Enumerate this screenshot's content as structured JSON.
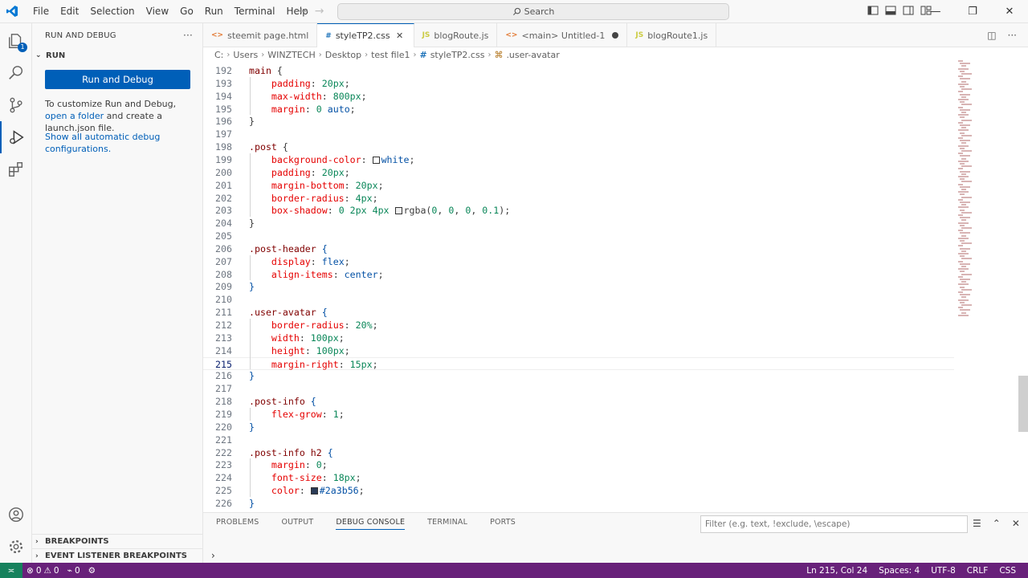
{
  "titlebar": {
    "menu": [
      "File",
      "Edit",
      "Selection",
      "View",
      "Go",
      "Run",
      "Terminal",
      "Help"
    ],
    "search_placeholder": "Search"
  },
  "sidebar": {
    "title": "RUN AND DEBUG",
    "section": "RUN",
    "run_button": "Run and Debug",
    "para1_prefix": "To customize Run and Debug, ",
    "para1_link": "open a folder",
    "para1_suffix": " and create a launch.json file.",
    "show_all_link": "Show all automatic debug configurations.",
    "breakpoints": "BREAKPOINTS",
    "event_breakpoints": "EVENT LISTENER BREAKPOINTS"
  },
  "tabs": [
    {
      "icon": "<>",
      "label": "steemit page.html"
    },
    {
      "icon": "#",
      "label": "styleTP2.css"
    },
    {
      "icon": "JS",
      "label": "blogRoute.js"
    },
    {
      "icon": "<>",
      "label": "<main>  Untitled-1"
    },
    {
      "icon": "JS",
      "label": "blogRoute1.js"
    }
  ],
  "breadcrumb": [
    "C:",
    "Users",
    "WINZTECH",
    "Desktop",
    "test file1",
    "styleTP2.css",
    ".user-avatar"
  ],
  "editor": {
    "current_line": 215,
    "lines": [
      {
        "n": "192",
        "tokens": [
          [
            "sel",
            "main "
          ],
          [
            "brace",
            "{"
          ]
        ]
      },
      {
        "n": "193",
        "tokens": [
          [
            "sp",
            "    "
          ],
          [
            "prop",
            "padding"
          ],
          [
            "brace",
            ": "
          ],
          [
            "num",
            "20px"
          ],
          [
            "brace",
            ";"
          ]
        ]
      },
      {
        "n": "194",
        "tokens": [
          [
            "sp",
            "    "
          ],
          [
            "prop",
            "max-width"
          ],
          [
            "brace",
            ": "
          ],
          [
            "num",
            "800px"
          ],
          [
            "brace",
            ";"
          ]
        ]
      },
      {
        "n": "195",
        "tokens": [
          [
            "sp",
            "    "
          ],
          [
            "prop",
            "margin"
          ],
          [
            "brace",
            ": "
          ],
          [
            "num",
            "0"
          ],
          [
            "brace",
            " "
          ],
          [
            "val",
            "auto"
          ],
          [
            "brace",
            ";"
          ]
        ]
      },
      {
        "n": "196",
        "tokens": [
          [
            "brace",
            "}"
          ]
        ]
      },
      {
        "n": "197",
        "tokens": []
      },
      {
        "n": "198",
        "tokens": [
          [
            "sel",
            ".post "
          ],
          [
            "brace",
            "{"
          ]
        ]
      },
      {
        "n": "199",
        "tokens": [
          [
            "sp",
            "    "
          ],
          [
            "prop",
            "background-color"
          ],
          [
            "brace",
            ": "
          ],
          [
            "swatch",
            "#ffffff"
          ],
          [
            "val",
            "white"
          ],
          [
            "brace",
            ";"
          ]
        ]
      },
      {
        "n": "200",
        "tokens": [
          [
            "sp",
            "    "
          ],
          [
            "prop",
            "padding"
          ],
          [
            "brace",
            ": "
          ],
          [
            "num",
            "20px"
          ],
          [
            "brace",
            ";"
          ]
        ]
      },
      {
        "n": "201",
        "tokens": [
          [
            "sp",
            "    "
          ],
          [
            "prop",
            "margin-bottom"
          ],
          [
            "brace",
            ": "
          ],
          [
            "num",
            "20px"
          ],
          [
            "brace",
            ";"
          ]
        ]
      },
      {
        "n": "202",
        "tokens": [
          [
            "sp",
            "    "
          ],
          [
            "prop",
            "border-radius"
          ],
          [
            "brace",
            ": "
          ],
          [
            "num",
            "4px"
          ],
          [
            "brace",
            ";"
          ]
        ]
      },
      {
        "n": "203",
        "tokens": [
          [
            "sp",
            "    "
          ],
          [
            "prop",
            "box-shadow"
          ],
          [
            "brace",
            ": "
          ],
          [
            "num",
            "0 2px 4px "
          ],
          [
            "swatch",
            "#f0f0f0"
          ],
          [
            "brace",
            "rgba("
          ],
          [
            "num",
            "0"
          ],
          [
            "brace",
            ", "
          ],
          [
            "num",
            "0"
          ],
          [
            "brace",
            ", "
          ],
          [
            "num",
            "0"
          ],
          [
            "brace",
            ", "
          ],
          [
            "num",
            "0.1"
          ],
          [
            "brace",
            ");"
          ]
        ]
      },
      {
        "n": "204",
        "tokens": [
          [
            "brace",
            "}"
          ]
        ]
      },
      {
        "n": "205",
        "tokens": []
      },
      {
        "n": "206",
        "tokens": [
          [
            "sel",
            ".post-header "
          ],
          [
            "val",
            "{"
          ]
        ]
      },
      {
        "n": "207",
        "tokens": [
          [
            "sp",
            "    "
          ],
          [
            "prop",
            "display"
          ],
          [
            "brace",
            ": "
          ],
          [
            "val",
            "flex"
          ],
          [
            "brace",
            ";"
          ]
        ]
      },
      {
        "n": "208",
        "tokens": [
          [
            "sp",
            "    "
          ],
          [
            "prop",
            "align-items"
          ],
          [
            "brace",
            ": "
          ],
          [
            "val",
            "center"
          ],
          [
            "brace",
            ";"
          ]
        ]
      },
      {
        "n": "209",
        "tokens": [
          [
            "val",
            "}"
          ]
        ]
      },
      {
        "n": "210",
        "tokens": []
      },
      {
        "n": "211",
        "tokens": [
          [
            "sel",
            ".user-avatar "
          ],
          [
            "val",
            "{"
          ]
        ]
      },
      {
        "n": "212",
        "tokens": [
          [
            "sp",
            "    "
          ],
          [
            "prop",
            "border-radius"
          ],
          [
            "brace",
            ": "
          ],
          [
            "num",
            "20%"
          ],
          [
            "brace",
            ";"
          ]
        ]
      },
      {
        "n": "213",
        "tokens": [
          [
            "sp",
            "    "
          ],
          [
            "prop",
            "width"
          ],
          [
            "brace",
            ": "
          ],
          [
            "num",
            "100px"
          ],
          [
            "brace",
            ";"
          ]
        ]
      },
      {
        "n": "214",
        "tokens": [
          [
            "sp",
            "    "
          ],
          [
            "prop",
            "height"
          ],
          [
            "brace",
            ": "
          ],
          [
            "num",
            "100px"
          ],
          [
            "brace",
            ";"
          ]
        ]
      },
      {
        "n": "215",
        "tokens": [
          [
            "sp",
            "    "
          ],
          [
            "prop",
            "margin-right"
          ],
          [
            "brace",
            ": "
          ],
          [
            "num",
            "15px"
          ],
          [
            "brace",
            ";"
          ]
        ]
      },
      {
        "n": "216",
        "tokens": [
          [
            "val",
            "}"
          ]
        ]
      },
      {
        "n": "217",
        "tokens": []
      },
      {
        "n": "218",
        "tokens": [
          [
            "sel",
            ".post-info "
          ],
          [
            "val",
            "{"
          ]
        ]
      },
      {
        "n": "219",
        "tokens": [
          [
            "sp",
            "    "
          ],
          [
            "prop",
            "flex-grow"
          ],
          [
            "brace",
            ": "
          ],
          [
            "num",
            "1"
          ],
          [
            "brace",
            ";"
          ]
        ]
      },
      {
        "n": "220",
        "tokens": [
          [
            "val",
            "}"
          ]
        ]
      },
      {
        "n": "221",
        "tokens": []
      },
      {
        "n": "222",
        "tokens": [
          [
            "sel",
            ".post-info h2 "
          ],
          [
            "val",
            "{"
          ]
        ]
      },
      {
        "n": "223",
        "tokens": [
          [
            "sp",
            "    "
          ],
          [
            "prop",
            "margin"
          ],
          [
            "brace",
            ": "
          ],
          [
            "num",
            "0"
          ],
          [
            "brace",
            ";"
          ]
        ]
      },
      {
        "n": "224",
        "tokens": [
          [
            "sp",
            "    "
          ],
          [
            "prop",
            "font-size"
          ],
          [
            "brace",
            ": "
          ],
          [
            "num",
            "18px"
          ],
          [
            "brace",
            ";"
          ]
        ]
      },
      {
        "n": "225",
        "tokens": [
          [
            "sp",
            "    "
          ],
          [
            "prop",
            "color"
          ],
          [
            "brace",
            ": "
          ],
          [
            "swatch",
            "#2a3b56"
          ],
          [
            "val",
            "#2a3b56"
          ],
          [
            "brace",
            ";"
          ]
        ]
      },
      {
        "n": "226",
        "tokens": [
          [
            "val",
            "}"
          ]
        ]
      }
    ]
  },
  "panel": {
    "tabs": [
      "PROBLEMS",
      "OUTPUT",
      "DEBUG CONSOLE",
      "TERMINAL",
      "PORTS"
    ],
    "active_tab": "DEBUG CONSOLE",
    "filter_placeholder": "Filter (e.g. text, !exclude, \\escape)"
  },
  "statusbar": {
    "errors": "0",
    "warnings": "0",
    "ports": "0",
    "position": "Ln 215, Col 24",
    "spaces": "Spaces: 4",
    "encoding": "UTF-8",
    "eol": "CRLF",
    "language": "CSS"
  },
  "colors": {
    "accent": "#005fb8",
    "statusbar": "#68217a",
    "remote": "#16825d"
  }
}
